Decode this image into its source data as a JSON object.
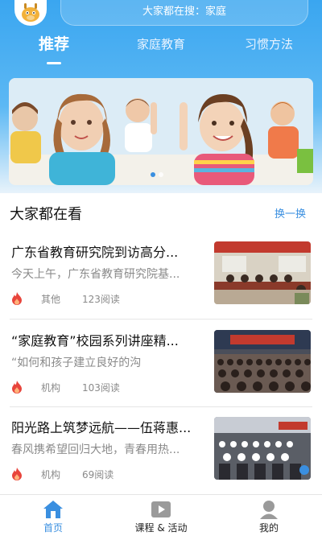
{
  "header": {
    "search_text": "大家都在搜：家庭",
    "tabs": [
      {
        "label": "推荐",
        "active": true
      },
      {
        "label": "家庭教育",
        "active": false
      },
      {
        "label": "习惯方法",
        "active": false
      }
    ]
  },
  "banner": {
    "slide_count": 2,
    "active_slide": 1
  },
  "section": {
    "title": "大家都在看",
    "refresh_label": "换一换"
  },
  "articles": [
    {
      "title": "广东省教育研究院到访高分...",
      "summary": "今天上午，广东省教育研究院基...",
      "source": "其他",
      "reads": "123阅读"
    },
    {
      "title": "“家庭教育”校园系列讲座精...",
      "summary": "“如何和孩子建立良好的沟",
      "source": "机构",
      "reads": "103阅读"
    },
    {
      "title": "阳光路上筑梦远航——伍蒋惠...",
      "summary": "春风携希望回归大地，青春用热...",
      "source": "机构",
      "reads": "69阅读"
    }
  ],
  "bottom_nav": [
    {
      "label": "首页",
      "icon": "home-icon",
      "active": true
    },
    {
      "label": "课程 & 活动",
      "icon": "video-icon",
      "active": false
    },
    {
      "label": "我的",
      "icon": "user-icon",
      "active": false
    }
  ],
  "colors": {
    "header_blue": "#3aa6f0",
    "accent": "#3a8fe0",
    "fire_red": "#e8453c"
  }
}
